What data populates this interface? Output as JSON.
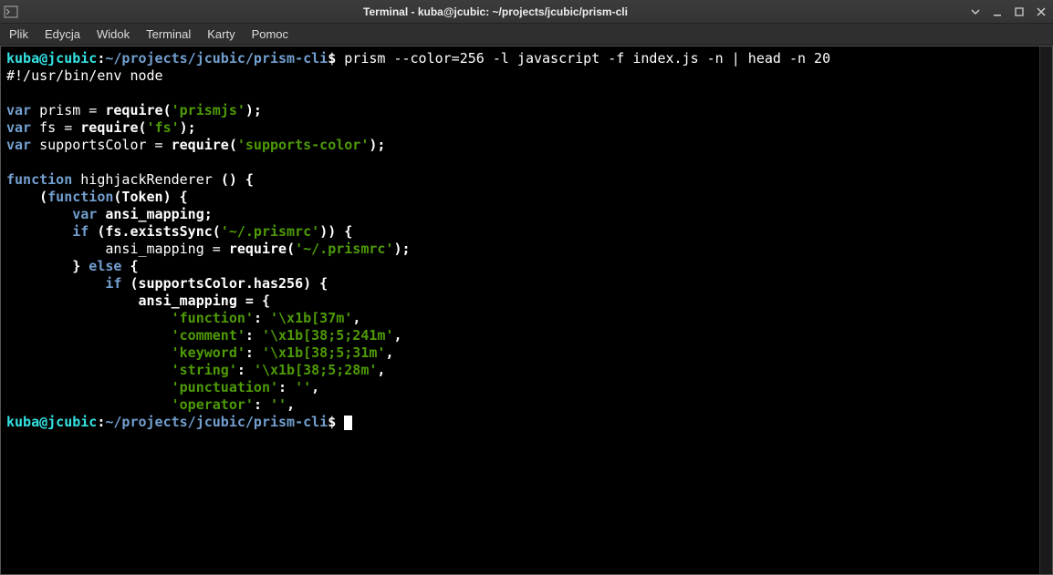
{
  "window": {
    "title": "Terminal - kuba@jcubic: ~/projects/jcubic/prism-cli"
  },
  "menubar": {
    "items": [
      "Plik",
      "Edycja",
      "Widok",
      "Terminal",
      "Karty",
      "Pomoc"
    ]
  },
  "prompt": {
    "user": "kuba@jcubic",
    "sep": ":",
    "path": "~/projects/jcubic/prism-cli",
    "symbol": "$"
  },
  "command": "prism --color=256 -l javascript -f index.js -n | head -n 20",
  "code": {
    "l01": "#!/usr/bin/env node",
    "l02_kw": "var",
    "l02_id": " prism = ",
    "l02_req": "require",
    "l02_p1": "(",
    "l02_str": "'prismjs'",
    "l02_p2": ");",
    "l03_kw": "var",
    "l03_id": " fs = ",
    "l03_req": "require",
    "l03_p1": "(",
    "l03_str": "'fs'",
    "l03_p2": ");",
    "l04_kw": "var",
    "l04_id": " supportsColor = ",
    "l04_req": "require",
    "l04_p1": "(",
    "l04_str": "'supports-color'",
    "l04_p2": ");",
    "l05_kw": "function",
    "l05_n": " highjackRenderer ",
    "l05_p": "() {",
    "l06_p1": "    (",
    "l06_kw": "function",
    "l06_p2": "(Token) {",
    "l07_i": "        ",
    "l07_kw": "var",
    "l07_t": " ansi_mapping;",
    "l08_i": "        ",
    "l08_kw": "if",
    "l08_p1": " (fs.",
    "l08_m": "existsSync",
    "l08_p2": "(",
    "l08_str": "'~/.prismrc'",
    "l08_p3": ")) {",
    "l09_i": "            ansi_mapping = ",
    "l09_req": "require",
    "l09_p1": "(",
    "l09_str": "'~/.prismrc'",
    "l09_p2": ");",
    "l10_i": "        ",
    "l10_p1": "}",
    "l10_kw": " else ",
    "l10_p2": "{",
    "l11_i": "            ",
    "l11_kw": "if",
    "l11_t": " (supportsColor.has256) {",
    "l12_t": "                ansi_mapping = {",
    "l13_i": "                    ",
    "l13_k": "'function'",
    "l13_s": ": ",
    "l13_v": "'\\x1b[37m'",
    "l13_c": ",",
    "l14_i": "                    ",
    "l14_k": "'comment'",
    "l14_s": ": ",
    "l14_v": "'\\x1b[38;5;241m'",
    "l14_c": ",",
    "l15_i": "                    ",
    "l15_k": "'keyword'",
    "l15_s": ": ",
    "l15_v": "'\\x1b[38;5;31m'",
    "l15_c": ",",
    "l16_i": "                    ",
    "l16_k": "'string'",
    "l16_s": ": ",
    "l16_v": "'\\x1b[38;5;28m'",
    "l16_c": ",",
    "l17_i": "                    ",
    "l17_k": "'punctuation'",
    "l17_s": ": ",
    "l17_v": "''",
    "l17_c": ",",
    "l18_i": "                    ",
    "l18_k": "'operator'",
    "l18_s": ": ",
    "l18_v": "''",
    "l18_c": ","
  }
}
